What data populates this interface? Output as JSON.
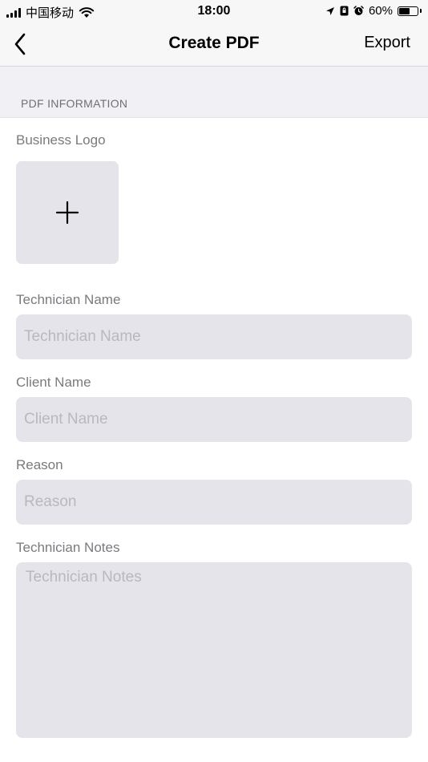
{
  "status_bar": {
    "carrier": "中国移动",
    "time": "18:00",
    "battery_percent_label": "60%",
    "battery_level": 0.6,
    "icons": [
      "signal-icon",
      "wifi-icon",
      "location-arrow-icon",
      "portrait-lock-icon",
      "alarm-icon",
      "battery-icon"
    ]
  },
  "nav": {
    "back_icon": "chevron-left-icon",
    "title": "Create PDF",
    "export_label": "Export"
  },
  "section": {
    "header": "PDF INFORMATION"
  },
  "form": {
    "business_logo_label": "Business Logo",
    "add_logo_icon": "plus-icon",
    "technician_name": {
      "label": "Technician Name",
      "placeholder": "Technician Name",
      "value": ""
    },
    "client_name": {
      "label": "Client Name",
      "placeholder": "Client Name",
      "value": ""
    },
    "reason": {
      "label": "Reason",
      "placeholder": "Reason",
      "value": ""
    },
    "technician_notes": {
      "label": "Technician Notes",
      "placeholder": "Technician Notes",
      "value": ""
    }
  }
}
